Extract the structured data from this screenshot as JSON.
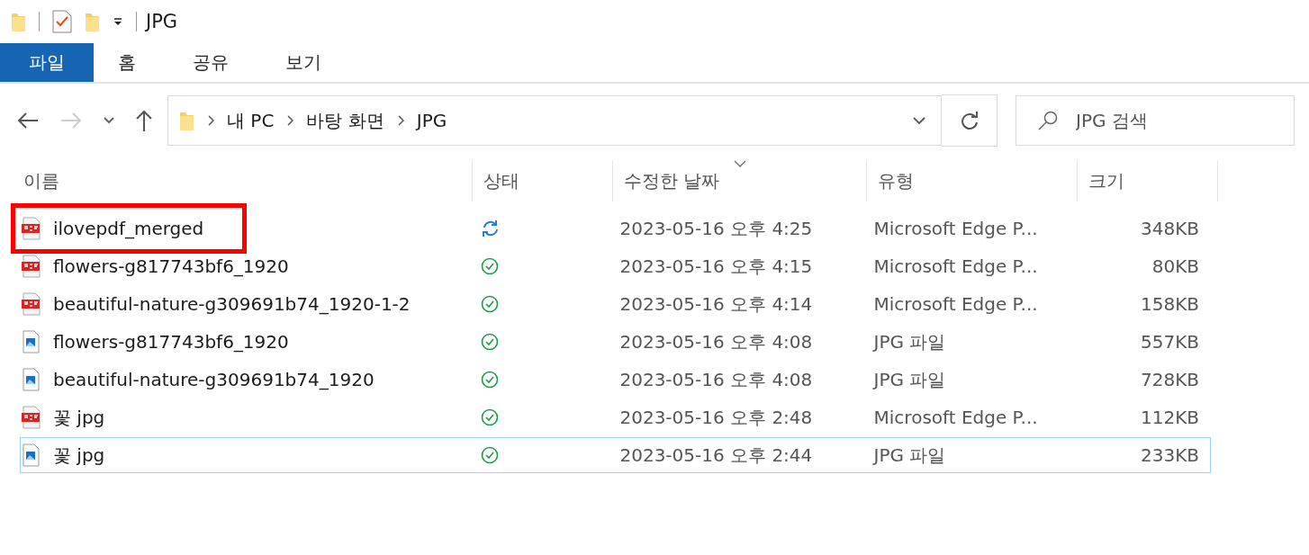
{
  "window": {
    "title": "JPG"
  },
  "ribbon_tabs": [
    {
      "label": "파일",
      "selected": true
    },
    {
      "label": "홈",
      "selected": false
    },
    {
      "label": "공유",
      "selected": false
    },
    {
      "label": "보기",
      "selected": false
    }
  ],
  "address": {
    "path": [
      "내 PC",
      "바탕 화면",
      "JPG"
    ]
  },
  "search": {
    "placeholder": "JPG 검색"
  },
  "table": {
    "columns": [
      {
        "label": "이름",
        "sorted": false
      },
      {
        "label": "상태",
        "sorted": false
      },
      {
        "label": "수정한 날짜",
        "sorted": true
      },
      {
        "label": "유형",
        "sorted": false
      },
      {
        "label": "크기",
        "sorted": false
      }
    ],
    "rows": [
      {
        "name": "ilovepdf_merged",
        "kind": "pdf",
        "status": {
          "kind": "syncing"
        },
        "date": "2023-05-16 오후 4:25",
        "type": "Microsoft Edge P...",
        "size": "348KB",
        "focused": false,
        "highlighted": true
      },
      {
        "name": "flowers-g817743bf6_1920",
        "kind": "pdf",
        "status": {
          "kind": "synced"
        },
        "date": "2023-05-16 오후 4:15",
        "type": "Microsoft Edge P...",
        "size": "80KB",
        "focused": false,
        "highlighted": false
      },
      {
        "name": "beautiful-nature-g309691b74_1920-1-2",
        "kind": "pdf",
        "status": {
          "kind": "synced"
        },
        "date": "2023-05-16 오후 4:14",
        "type": "Microsoft Edge P...",
        "size": "158KB",
        "focused": false,
        "highlighted": false
      },
      {
        "name": "flowers-g817743bf6_1920",
        "kind": "image",
        "status": {
          "kind": "synced"
        },
        "date": "2023-05-16 오후 4:08",
        "type": "JPG 파일",
        "size": "557KB",
        "focused": false,
        "highlighted": false
      },
      {
        "name": "beautiful-nature-g309691b74_1920",
        "kind": "image",
        "status": {
          "kind": "synced"
        },
        "date": "2023-05-16 오후 4:08",
        "type": "JPG 파일",
        "size": "728KB",
        "focused": false,
        "highlighted": false
      },
      {
        "name": "꽃 jpg",
        "kind": "pdf",
        "status": {
          "kind": "synced"
        },
        "date": "2023-05-16 오후 2:48",
        "type": "Microsoft Edge P...",
        "size": "112KB",
        "focused": false,
        "highlighted": false
      },
      {
        "name": "꽃 jpg",
        "kind": "image",
        "status": {
          "kind": "synced"
        },
        "date": "2023-05-16 오후 2:44",
        "type": "JPG 파일",
        "size": "233KB",
        "focused": true,
        "highlighted": false
      }
    ]
  }
}
